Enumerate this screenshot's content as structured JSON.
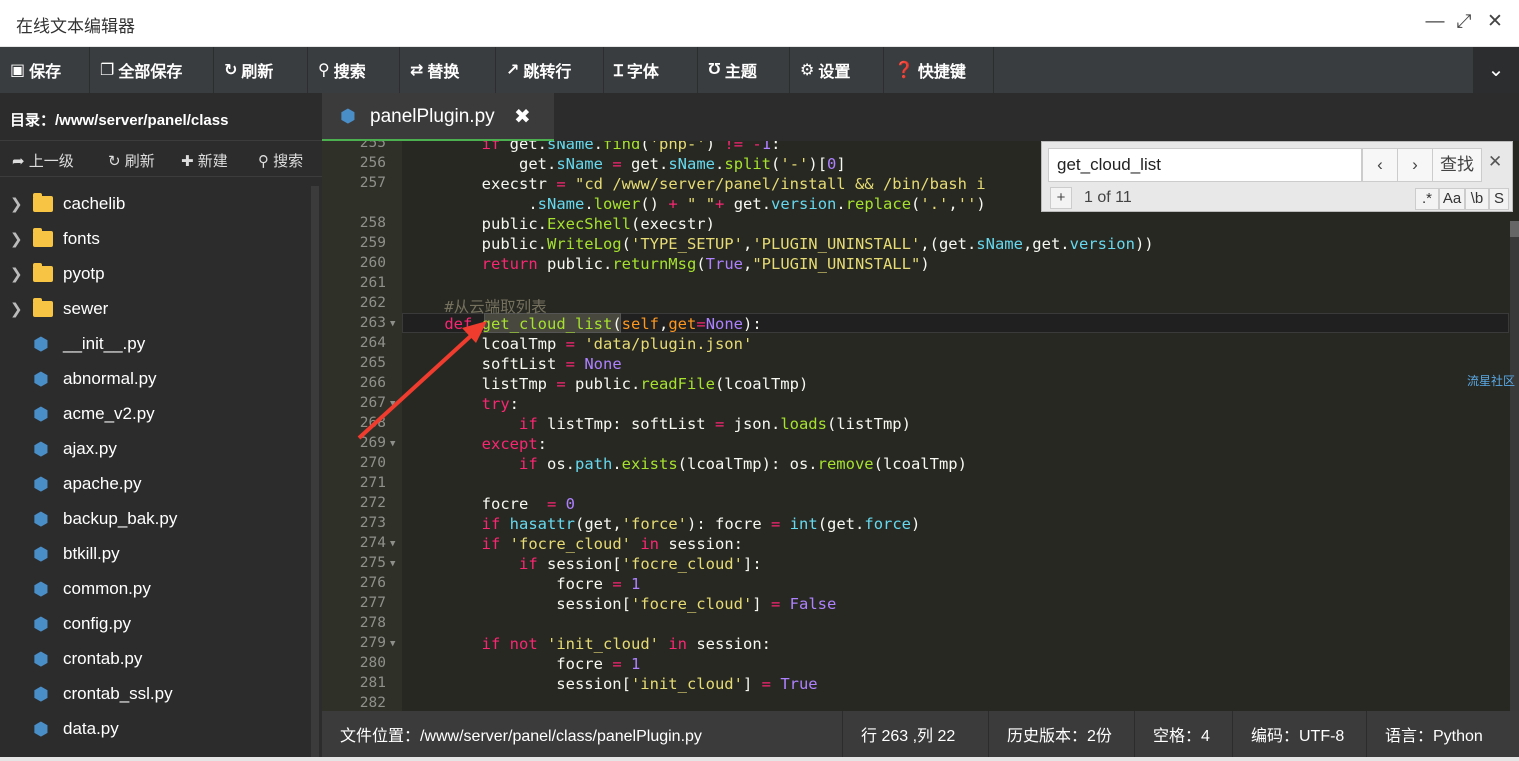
{
  "window": {
    "title": "在线文本编辑器",
    "minimize": "—",
    "maximize": "⤢",
    "close": "✕"
  },
  "toolbar": {
    "save": "保存",
    "save_all": "全部保存",
    "refresh": "刷新",
    "search": "搜索",
    "replace": "替换",
    "goto_line": "跳转行",
    "font": "字体",
    "theme": "主题",
    "settings": "设置",
    "shortcuts": "快捷键",
    "collapse": "⌄"
  },
  "sidebar": {
    "dir_label": "目录：/www/server/panel/class",
    "tools": {
      "up": "上一级",
      "refresh": "刷新",
      "new": "新建",
      "search": "搜索"
    },
    "folders": [
      "cachelib",
      "fonts",
      "pyotp",
      "sewer"
    ],
    "files": [
      "__init__.py",
      "abnormal.py",
      "acme_v2.py",
      "ajax.py",
      "apache.py",
      "backup_bak.py",
      "btkill.py",
      "common.py",
      "config.py",
      "crontab.py",
      "crontab_ssl.py",
      "data.py"
    ]
  },
  "tab": {
    "label": "panelPlugin.py",
    "close": "✖"
  },
  "search_panel": {
    "query": "get_cloud_list",
    "prev": "‹",
    "next": "›",
    "find": "查找",
    "close": "✕",
    "plus": "+",
    "count": "1 of 11",
    "opt_regex": ".*",
    "opt_case": "Aa",
    "opt_word": "\\b",
    "opt_sel": "S"
  },
  "editor": {
    "active_line": 263,
    "line_numbers": [
      "255",
      "256",
      "257",
      "",
      "258",
      "259",
      "260",
      "261",
      "262",
      "263",
      "264",
      "265",
      "266",
      "267",
      "268",
      "269",
      "270",
      "271",
      "272",
      "273",
      "274",
      "275",
      "276",
      "277",
      "278",
      "279",
      "280",
      "281",
      "282"
    ]
  },
  "watermark": "流星社区",
  "status": {
    "file_path": "文件位置：/www/server/panel/class/panelPlugin.py",
    "cursor": "行 263 ,列 22",
    "history": "历史版本：2份",
    "indent": "空格：4",
    "encoding": "编码：UTF-8",
    "language": "语言：Python"
  }
}
